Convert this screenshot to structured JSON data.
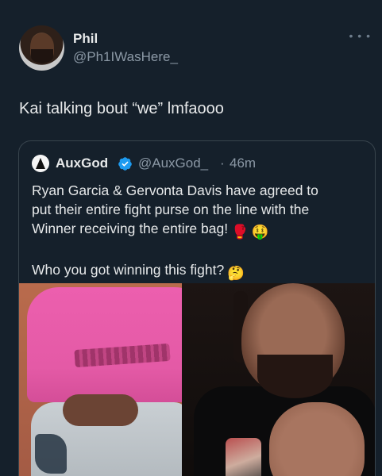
{
  "tweet": {
    "author": {
      "name": "Phil",
      "handle": "@Ph1IWasHere_",
      "avatar_icon": "user-avatar"
    },
    "more_icon": "ellipsis-icon",
    "text": "Kai talking bout “we” lmfaooo"
  },
  "quoted_tweet": {
    "author": {
      "name": "AuxGod",
      "handle": "@AuxGod_",
      "separator": "·",
      "time": "46m",
      "verified": true,
      "verified_color": "#1d9bf0"
    },
    "text_lines": [
      "Ryan Garcia & Gervonta Davis have agreed to",
      "put their entire fight purse on the line with the",
      "Winner receiving the entire bag!"
    ],
    "line3_emojis": [
      "🥊",
      "🤑"
    ],
    "question": "Who you got winning this fight?",
    "question_emoji": "🤔",
    "media_alt_icon": "video-thumbnail"
  },
  "colors": {
    "background": "#15202b",
    "text": "#e7e9ea",
    "secondary_text": "#8b98a5",
    "border": "#38444d"
  }
}
